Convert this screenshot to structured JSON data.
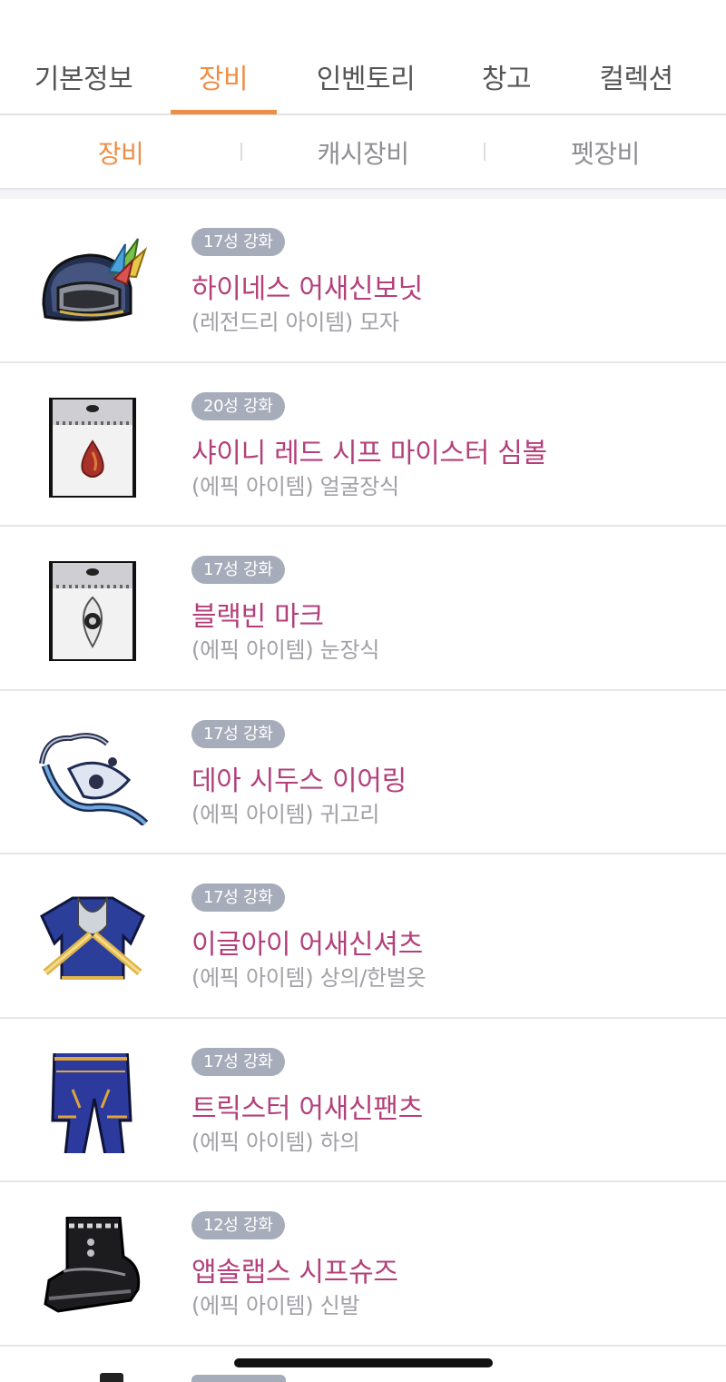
{
  "top_tabs": [
    {
      "label": "기본정보",
      "active": false
    },
    {
      "label": "장비",
      "active": true
    },
    {
      "label": "인벤토리",
      "active": false
    },
    {
      "label": "창고",
      "active": false
    },
    {
      "label": "컬렉션",
      "active": false
    }
  ],
  "sub_tabs": [
    {
      "label": "장비",
      "active": true
    },
    {
      "label": "캐시장비",
      "active": false
    },
    {
      "label": "펫장비",
      "active": false
    }
  ],
  "colors": {
    "accent": "#ee8e45",
    "item_name": "#b3407a",
    "badge_bg": "#a7acbb",
    "desc": "#a0a0a6"
  },
  "items": [
    {
      "badge": "17성 강화",
      "name": "하이네스 어새신보닛",
      "desc": "(레전드리 아이템) 모자",
      "icon": "helmet-icon"
    },
    {
      "badge": "20성 강화",
      "name": "샤이니 레드 시프 마이스터 심볼",
      "desc": "(에픽 아이템) 얼굴장식",
      "icon": "face-symbol-icon"
    },
    {
      "badge": "17성 강화",
      "name": "블랙빈 마크",
      "desc": "(에픽 아이템) 눈장식",
      "icon": "eye-mark-icon"
    },
    {
      "badge": "17성 강화",
      "name": "데아 시두스 이어링",
      "desc": "(에픽 아이템) 귀고리",
      "icon": "earring-icon"
    },
    {
      "badge": "17성 강화",
      "name": "이글아이 어새신셔츠",
      "desc": "(에픽 아이템) 상의/한벌옷",
      "icon": "shirt-icon"
    },
    {
      "badge": "17성 강화",
      "name": "트릭스터 어새신팬츠",
      "desc": "(에픽 아이템) 하의",
      "icon": "pants-icon"
    },
    {
      "badge": "12성 강화",
      "name": "앱솔랩스 시프슈즈",
      "desc": "(에픽 아이템) 신발",
      "icon": "shoes-icon"
    }
  ]
}
